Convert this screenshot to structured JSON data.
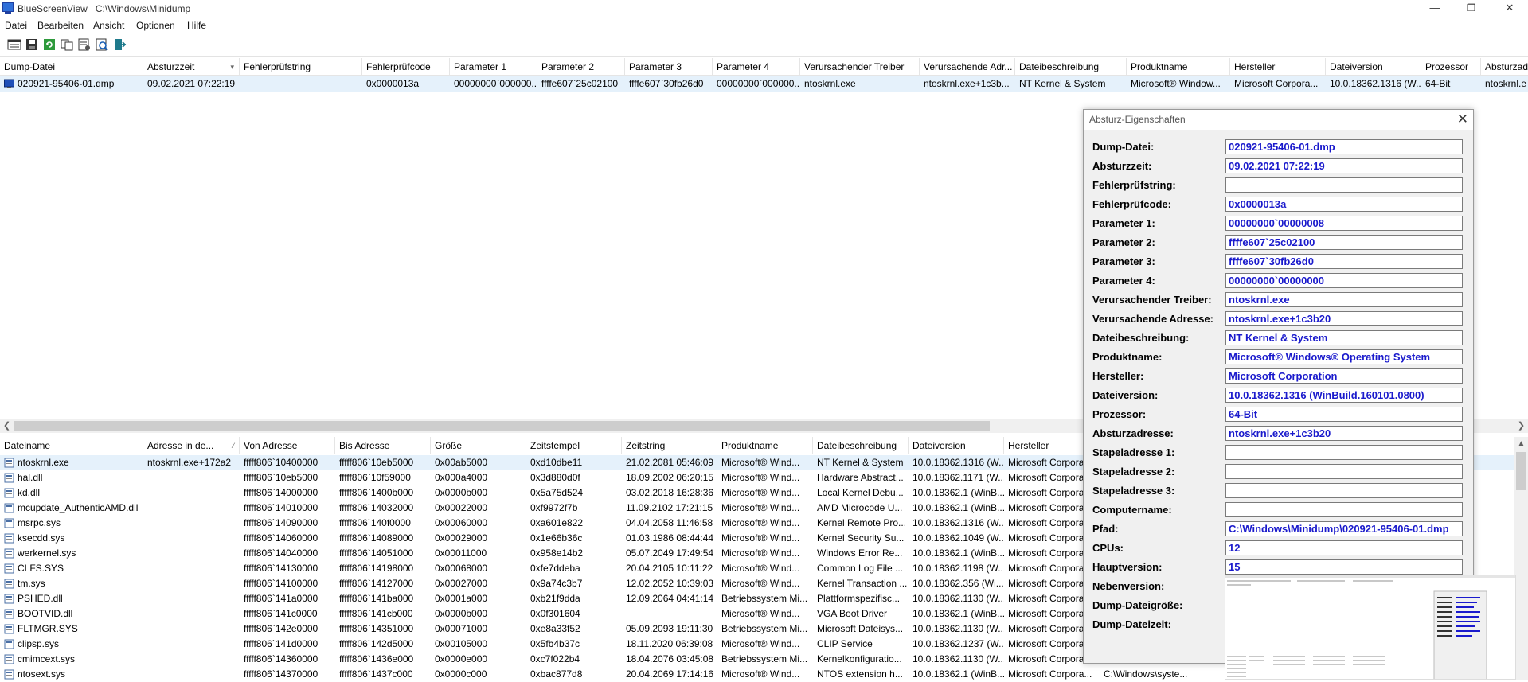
{
  "window": {
    "app_name": "BlueScreenView",
    "path": "C:\\Windows\\Minidump",
    "minimize": "—",
    "restore": "❐",
    "close": "✕"
  },
  "menu": [
    "Datei",
    "Bearbeiten",
    "Ansicht",
    "Optionen",
    "Hilfe"
  ],
  "toolbar_icons": [
    "properties-icon",
    "save-icon",
    "refresh-icon",
    "copy-icon",
    "options-icon",
    "find-icon",
    "exit-icon"
  ],
  "dump_table": {
    "columns": [
      "Dump-Datei",
      "Absturzzeit",
      "Fehlerprüfstring",
      "Fehlerprüfcode",
      "Parameter 1",
      "Parameter 2",
      "Parameter 3",
      "Parameter 4",
      "Verursachender Treiber",
      "Verursachende Adr...",
      "Dateibeschreibung",
      "Produktname",
      "Hersteller",
      "Dateiversion",
      "Prozessor",
      "Absturzad"
    ],
    "rows": [
      [
        "020921-95406-01.dmp",
        "09.02.2021 07:22:19",
        "",
        "0x0000013a",
        "00000000`000000...",
        "ffffe607`25c02100",
        "ffffe607`30fb26d0",
        "00000000`000000...",
        "ntoskrnl.exe",
        "ntoskrnl.exe+1c3b...",
        "NT Kernel & System",
        "Microsoft® Window...",
        "Microsoft Corpora...",
        "10.0.18362.1316 (W...",
        "64-Bit",
        "ntoskrnl.e"
      ]
    ]
  },
  "driver_table": {
    "columns": [
      "Dateiname",
      "Adresse in de...",
      "Von Adresse",
      "Bis Adresse",
      "Größe",
      "Zeitstempel",
      "Zeitstring",
      "Produktname",
      "Dateibeschreibung",
      "Dateiversion",
      "Hersteller",
      "Dateipfad"
    ],
    "rows": [
      [
        "ntoskrnl.exe",
        "ntoskrnl.exe+172a2",
        "fffff806`10400000",
        "fffff806`10eb5000",
        "0x00ab5000",
        "0xd10dbe11",
        "21.02.2081 05:46:09",
        "Microsoft® Wind...",
        "NT Kernel & System",
        "10.0.18362.1316 (W...",
        "Microsoft Corpora...",
        ""
      ],
      [
        "hal.dll",
        "",
        "fffff806`10eb5000",
        "fffff806`10f59000",
        "0x000a4000",
        "0x3d880d0f",
        "18.09.2002 06:20:15",
        "Microsoft® Wind...",
        "Hardware Abstract...",
        "10.0.18362.1171 (W...",
        "Microsoft Corpora...",
        ""
      ],
      [
        "kd.dll",
        "",
        "fffff806`14000000",
        "fffff806`1400b000",
        "0x0000b000",
        "0x5a75d524",
        "03.02.2018 16:28:36",
        "Microsoft® Wind...",
        "Local Kernel Debu...",
        "10.0.18362.1 (WinB...",
        "Microsoft Corpora...",
        ""
      ],
      [
        "mcupdate_AuthenticAMD.dll",
        "",
        "fffff806`14010000",
        "fffff806`14032000",
        "0x00022000",
        "0xf9972f7b",
        "11.09.2102 17:21:15",
        "Microsoft® Wind...",
        "AMD Microcode U...",
        "10.0.18362.1 (WinB...",
        "Microsoft Corpora...",
        ""
      ],
      [
        "msrpc.sys",
        "",
        "fffff806`14090000",
        "fffff806`140f0000",
        "0x00060000",
        "0xa601e822",
        "04.04.2058 11:46:58",
        "Microsoft® Wind...",
        "Kernel Remote Pro...",
        "10.0.18362.1316 (W...",
        "Microsoft Corpora...",
        ""
      ],
      [
        "ksecdd.sys",
        "",
        "fffff806`14060000",
        "fffff806`14089000",
        "0x00029000",
        "0x1e66b36c",
        "01.03.1986 08:44:44",
        "Microsoft® Wind...",
        "Kernel Security Su...",
        "10.0.18362.1049 (W...",
        "Microsoft Corpora...",
        ""
      ],
      [
        "werkernel.sys",
        "",
        "fffff806`14040000",
        "fffff806`14051000",
        "0x00011000",
        "0x958e14b2",
        "05.07.2049 17:49:54",
        "Microsoft® Wind...",
        "Windows Error Re...",
        "10.0.18362.1 (WinB...",
        "Microsoft Corpora...",
        ""
      ],
      [
        "CLFS.SYS",
        "",
        "fffff806`14130000",
        "fffff806`14198000",
        "0x00068000",
        "0xfe7ddeba",
        "20.04.2105 10:11:22",
        "Microsoft® Wind...",
        "Common Log File ...",
        "10.0.18362.1198 (W...",
        "Microsoft Corpora...",
        ""
      ],
      [
        "tm.sys",
        "",
        "fffff806`14100000",
        "fffff806`14127000",
        "0x00027000",
        "0x9a74c3b7",
        "12.02.2052 10:39:03",
        "Microsoft® Wind...",
        "Kernel Transaction ...",
        "10.0.18362.356 (Wi...",
        "Microsoft Corpora...",
        ""
      ],
      [
        "PSHED.dll",
        "",
        "fffff806`141a0000",
        "fffff806`141ba000",
        "0x0001a000",
        "0xb21f9dda",
        "12.09.2064 04:41:14",
        "Betriebssystem Mi...",
        "Plattformspezifisc...",
        "10.0.18362.1130 (W...",
        "Microsoft Corpora...",
        ""
      ],
      [
        "BOOTVID.dll",
        "",
        "fffff806`141c0000",
        "fffff806`141cb000",
        "0x0000b000",
        "0x0f301604",
        "",
        "Microsoft® Wind...",
        "VGA Boot Driver",
        "10.0.18362.1 (WinB...",
        "Microsoft Corpora...",
        ""
      ],
      [
        "FLTMGR.SYS",
        "",
        "fffff806`142e0000",
        "fffff806`14351000",
        "0x00071000",
        "0xe8a33f52",
        "05.09.2093 19:11:30",
        "Betriebssystem Mi...",
        "Microsoft Dateisys...",
        "10.0.18362.1130 (W...",
        "Microsoft Corpora...",
        ""
      ],
      [
        "clipsp.sys",
        "",
        "fffff806`141d0000",
        "fffff806`142d5000",
        "0x00105000",
        "0x5fb4b37c",
        "18.11.2020 06:39:08",
        "Microsoft® Wind...",
        "CLIP Service",
        "10.0.18362.1237 (W...",
        "Microsoft Corpora...",
        ""
      ],
      [
        "cmimcext.sys",
        "",
        "fffff806`14360000",
        "fffff806`1436e000",
        "0x0000e000",
        "0xc7f022b4",
        "18.04.2076 03:45:08",
        "Betriebssystem Mi...",
        "Kernelkonfiguratio...",
        "10.0.18362.1130 (W...",
        "Microsoft Corpora...",
        ""
      ],
      [
        "ntosext.sys",
        "",
        "fffff806`14370000",
        "fffff806`1437c000",
        "0x0000c000",
        "0xbac877d8",
        "20.04.2069 17:14:16",
        "Microsoft® Wind...",
        "NTOS extension h...",
        "10.0.18362.1 (WinB...",
        "Microsoft Corpora...",
        "C:\\Windows\\syste..."
      ]
    ]
  },
  "dialog": {
    "title": "Absturz-Eigenschaften",
    "close": "✕",
    "properties": [
      {
        "label": "Dump-Datei:",
        "value": "020921-95406-01.dmp"
      },
      {
        "label": "Absturzzeit:",
        "value": "09.02.2021 07:22:19"
      },
      {
        "label": "Fehlerprüfstring:",
        "value": ""
      },
      {
        "label": "Fehlerprüfcode:",
        "value": "0x0000013a"
      },
      {
        "label": "Parameter 1:",
        "value": "00000000`00000008"
      },
      {
        "label": "Parameter 2:",
        "value": "ffffe607`25c02100"
      },
      {
        "label": "Parameter 3:",
        "value": "ffffe607`30fb26d0"
      },
      {
        "label": "Parameter 4:",
        "value": "00000000`00000000"
      },
      {
        "label": "Verursachender Treiber:",
        "value": "ntoskrnl.exe"
      },
      {
        "label": "Verursachende Adresse:",
        "value": "ntoskrnl.exe+1c3b20"
      },
      {
        "label": "Dateibeschreibung:",
        "value": "NT Kernel & System"
      },
      {
        "label": "Produktname:",
        "value": "Microsoft® Windows® Operating System"
      },
      {
        "label": "Hersteller:",
        "value": "Microsoft Corporation"
      },
      {
        "label": "Dateiversion:",
        "value": "10.0.18362.1316 (WinBuild.160101.0800)"
      },
      {
        "label": "Prozessor:",
        "value": "64-Bit"
      },
      {
        "label": "Absturzadresse:",
        "value": "ntoskrnl.exe+1c3b20"
      },
      {
        "label": "Stapeladresse 1:",
        "value": ""
      },
      {
        "label": "Stapeladresse 2:",
        "value": ""
      },
      {
        "label": "Stapeladresse 3:",
        "value": ""
      },
      {
        "label": "Computername:",
        "value": ""
      },
      {
        "label": "Pfad:",
        "value": "C:\\Windows\\Minidump\\020921-95406-01.dmp"
      },
      {
        "label": "CPUs:",
        "value": "12"
      },
      {
        "label": "Hauptversion:",
        "value": "15"
      },
      {
        "label": "Nebenversion:",
        "value": null
      },
      {
        "label": "Dump-Dateigröße:",
        "value": null
      },
      {
        "label": "Dump-Dateizeit:",
        "value": null
      }
    ]
  },
  "colors": {
    "selection": "#e5f1fb",
    "value_text": "#1a1acc",
    "dialog_bg": "#f0f0f0"
  }
}
